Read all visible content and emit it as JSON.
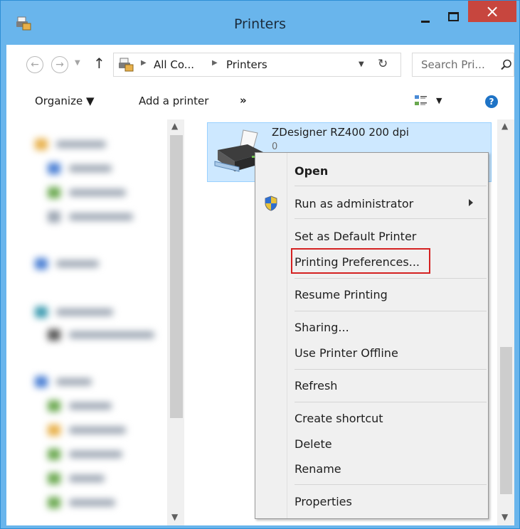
{
  "window": {
    "title": "Printers",
    "close_glyph": "×"
  },
  "colors": {
    "titlebar": "#69b5ec",
    "close": "#c7463e",
    "selection": "#cde8ff",
    "highlight_box": "#d42121"
  },
  "address_bar": {
    "crumbs": [
      "All Co...",
      "Printers"
    ],
    "icon": "devices-printers-icon"
  },
  "search": {
    "placeholder": "Search Pri..."
  },
  "toolbar": {
    "organize_label": "Organize ▼",
    "add_printer_label": "Add a printer",
    "more_label": "»",
    "help_label": "?"
  },
  "printer": {
    "name": "ZDesigner RZ400 200 dpi",
    "count": "0"
  },
  "context_menu": {
    "items": [
      {
        "label": "Open",
        "bold": true
      },
      {
        "label": "Run as administrator",
        "has_submenu": true,
        "icon": "uac-shield-icon"
      },
      {
        "label": "Set as Default Printer"
      },
      {
        "label": "Printing Preferences...",
        "highlighted": true
      },
      {
        "label": "Resume Printing"
      },
      {
        "label": "Sharing..."
      },
      {
        "label": "Use Printer Offline"
      },
      {
        "label": "Refresh"
      },
      {
        "label": "Create shortcut"
      },
      {
        "label": "Delete"
      },
      {
        "label": "Rename"
      },
      {
        "label": "Properties"
      }
    ]
  }
}
